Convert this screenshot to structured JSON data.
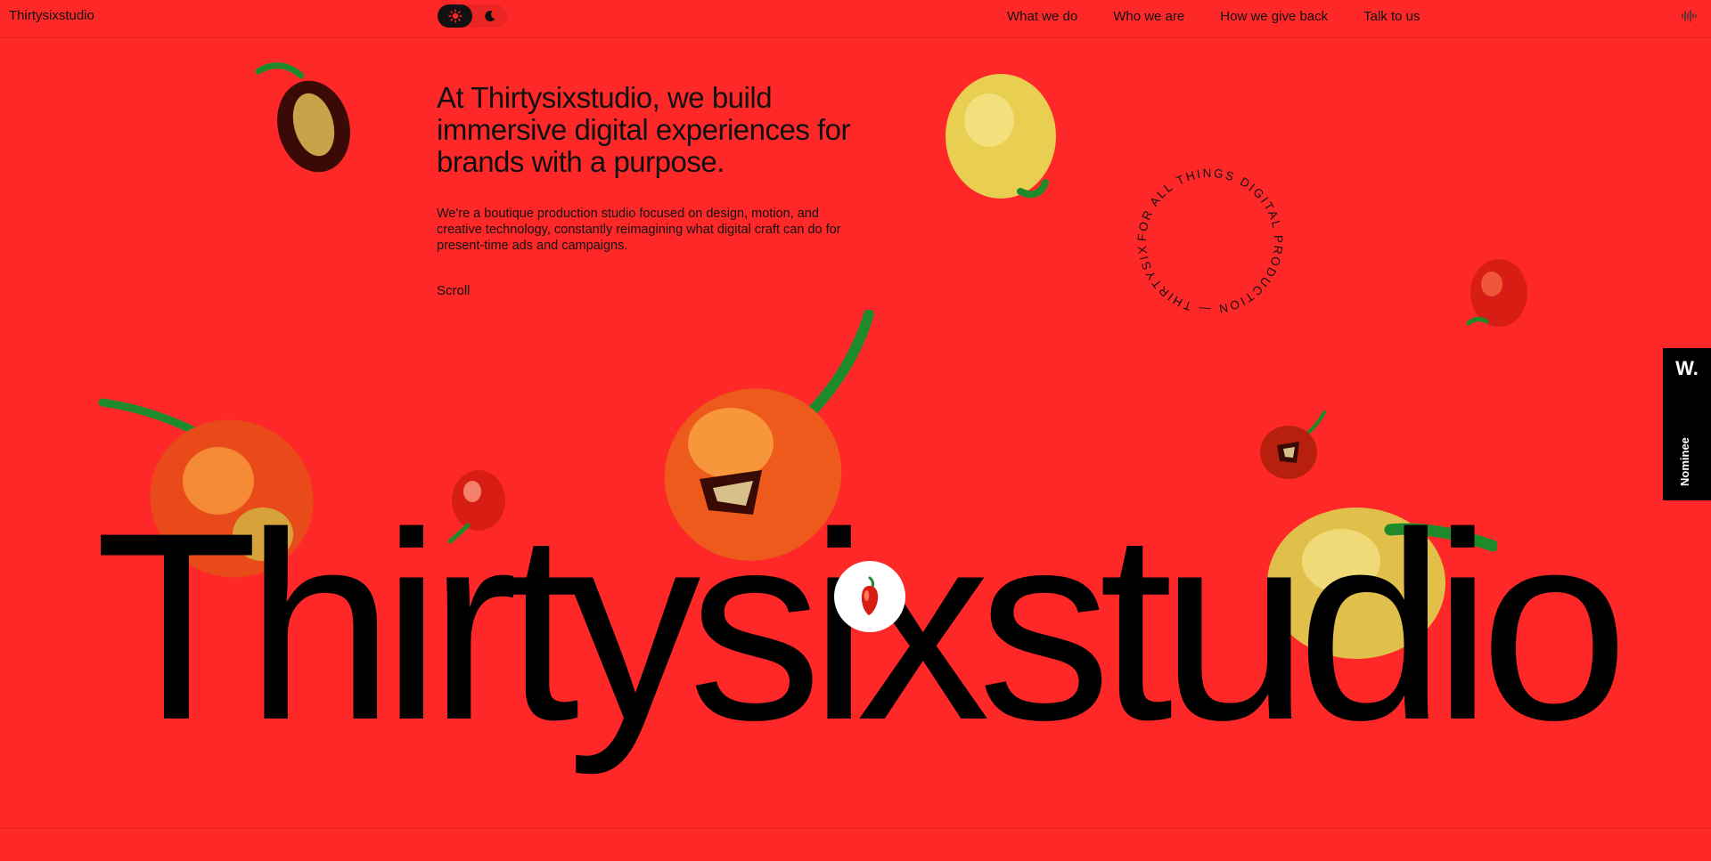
{
  "header": {
    "brand": "Thirtysixstudio",
    "nav": [
      "What we do",
      "Who we are",
      "How we give back",
      "Talk to us"
    ]
  },
  "hero": {
    "headline": "At Thirtysixstudio, we build immersive digital experiences for brands with a purpose.",
    "intro": "We're a boutique production studio focused on design, motion, and creative technology, constantly reimagining what digital craft can do for present-time ads and campaigns.",
    "scroll_label": "Scroll",
    "ring_text": "FOR ALL THINGS DIGITAL PRODUCTION — THIRTYSIXSTUDIO — ",
    "big_word": "Thirtysixstudio"
  },
  "award": {
    "logo": "W.",
    "label": "Nominee"
  },
  "colors": {
    "background": "#ff2828",
    "text": "#111111",
    "pepper_red": "#d81e14",
    "pepper_orange": "#f06a1a",
    "pepper_yellow": "#e8cf52",
    "stem_green": "#1f8a2c"
  },
  "icons": [
    "sun-icon",
    "moon-icon",
    "sound-wave-icon",
    "pepper-icon"
  ]
}
